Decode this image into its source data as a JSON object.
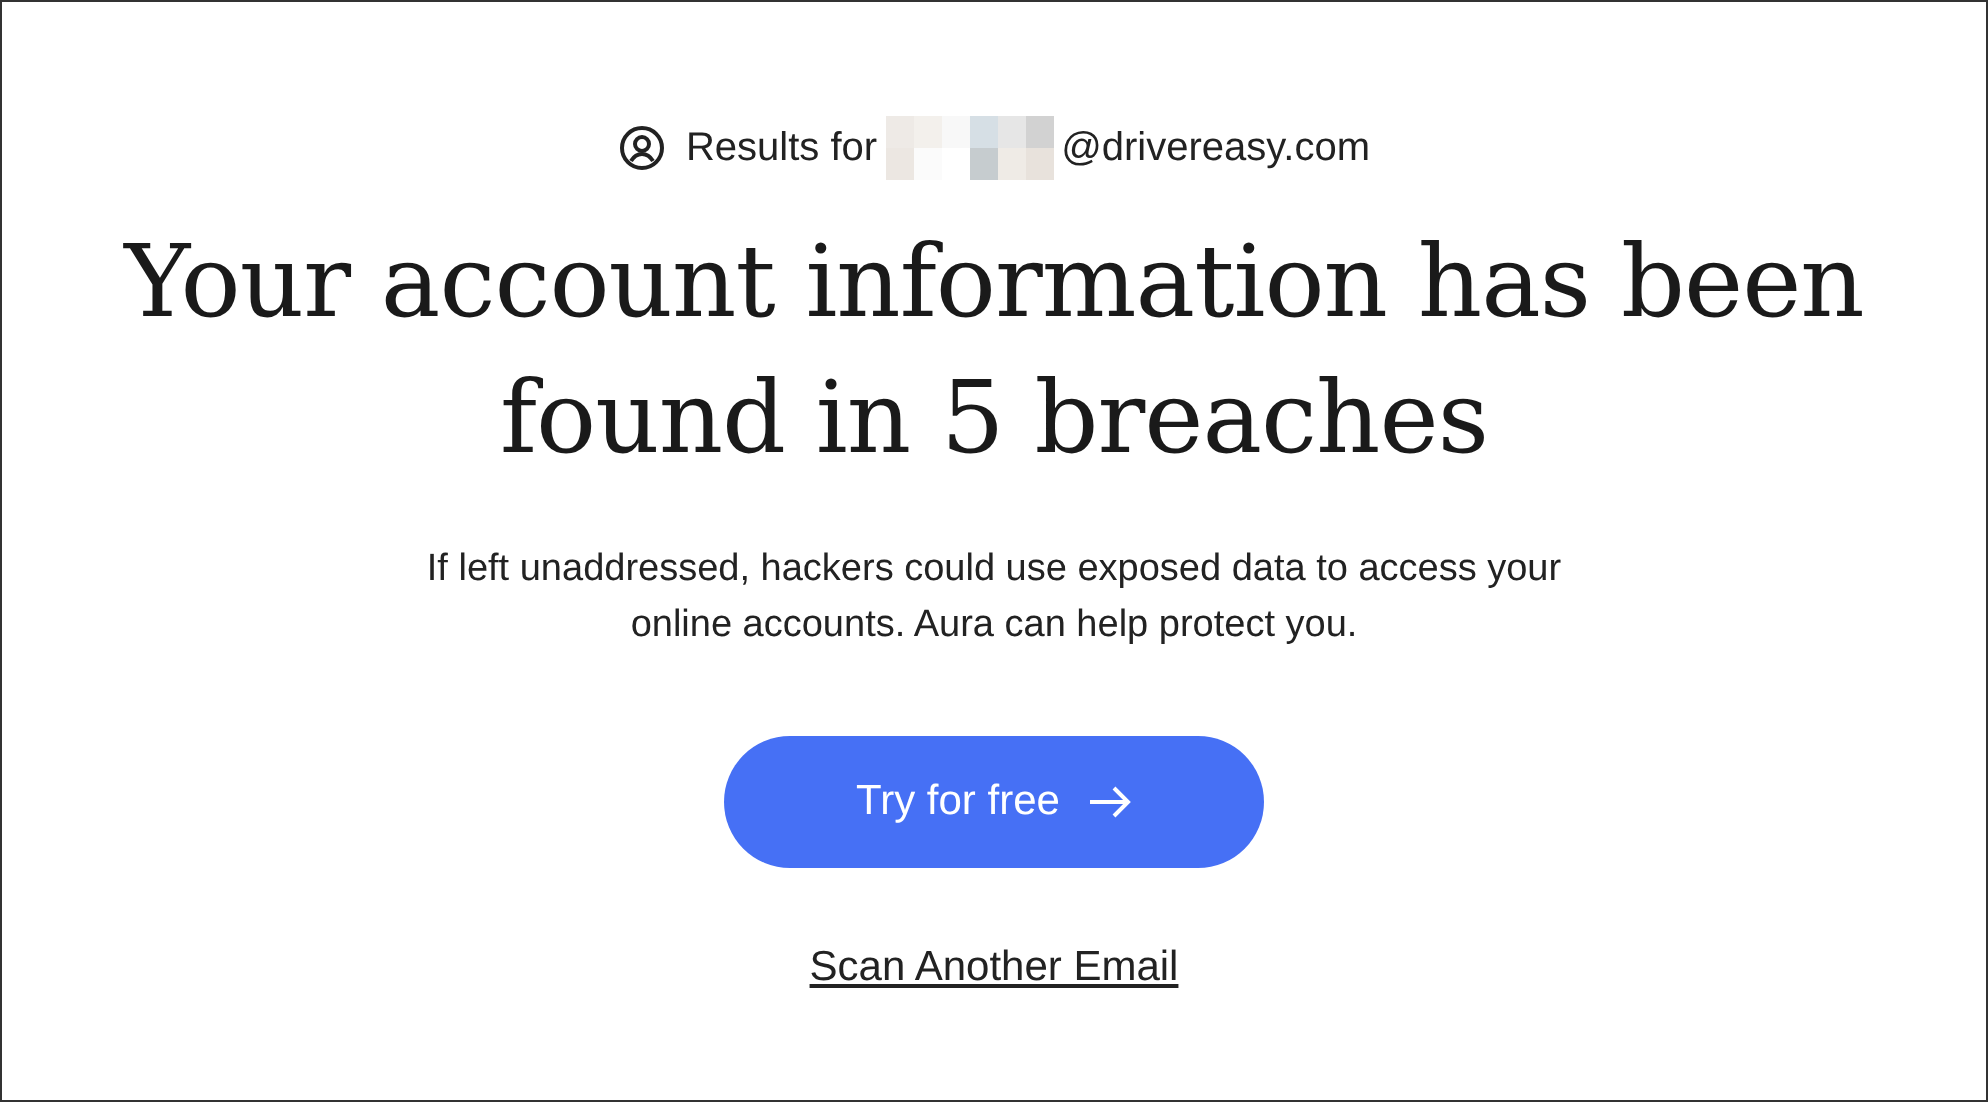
{
  "results": {
    "label": "Results for",
    "email_domain": "@drivereasy.com"
  },
  "headline": "Your account information has been found in 5 breaches",
  "description": "If left unaddressed, hackers could use exposed data to access your online accounts. Aura can help protect you.",
  "primary_button": {
    "label": "Try for free"
  },
  "link": "Scan Another Email"
}
